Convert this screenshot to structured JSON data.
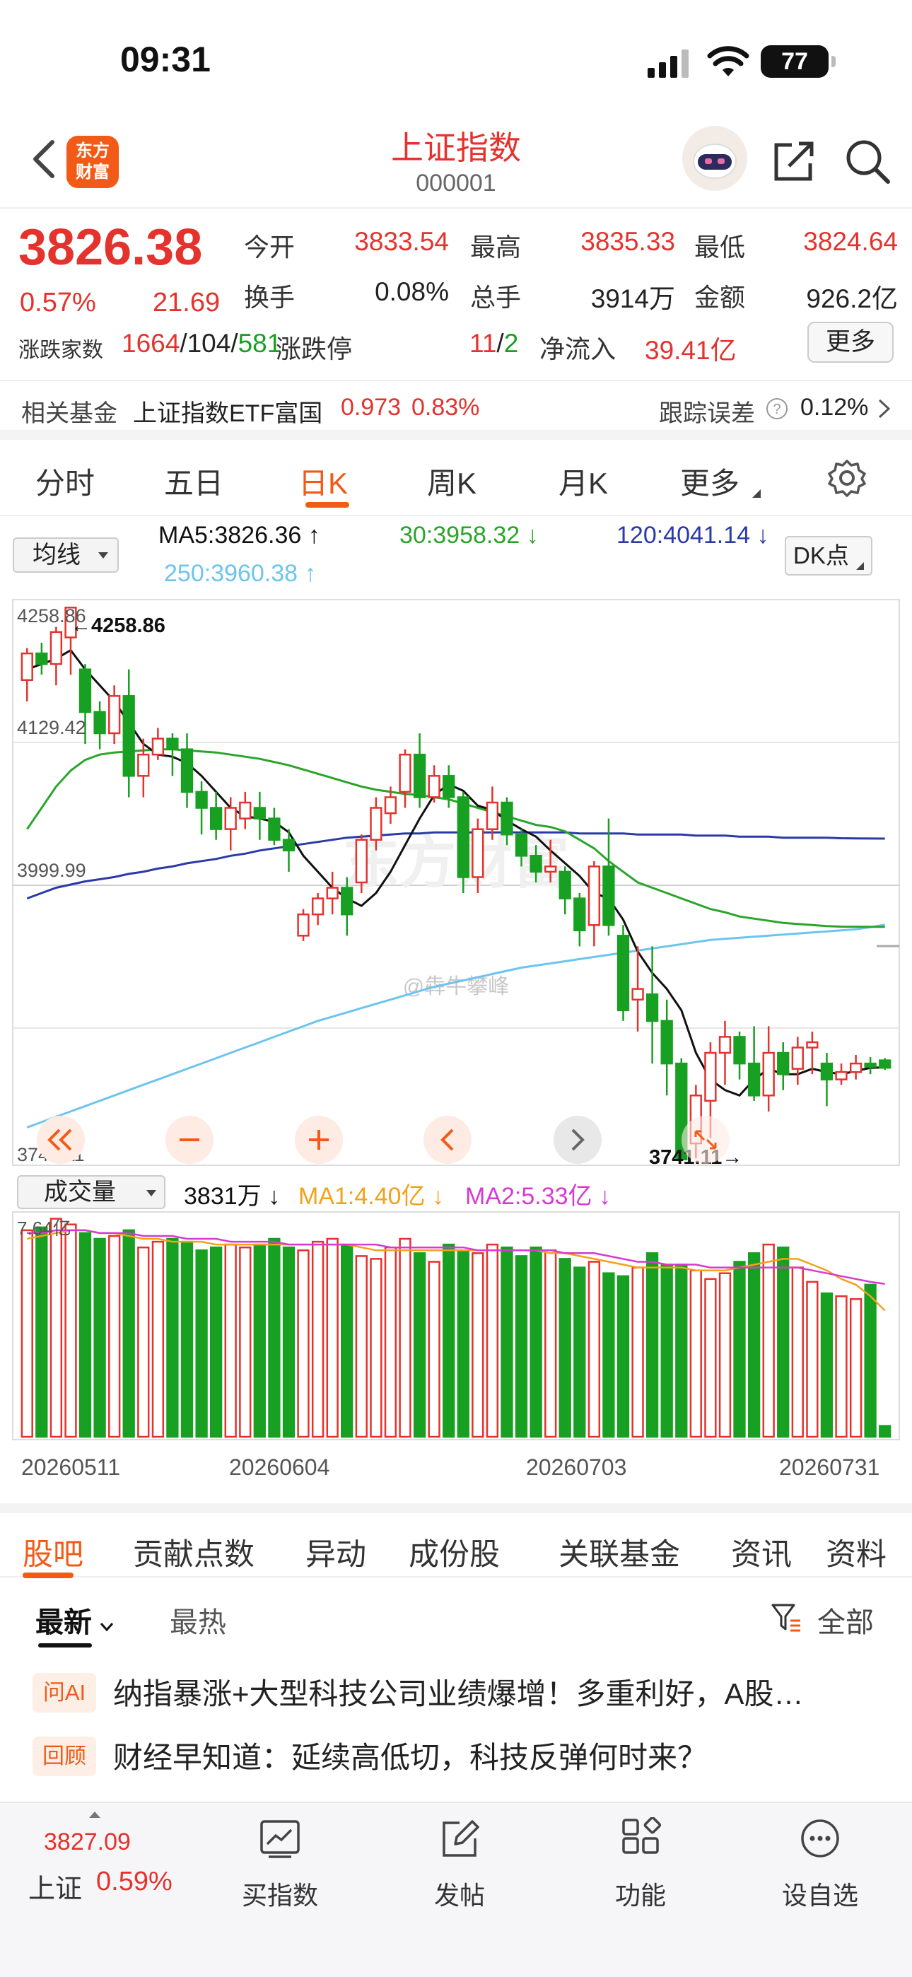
{
  "status_bar": {
    "time": "09:31",
    "battery": "77"
  },
  "header": {
    "title": "上证指数",
    "code": "000001",
    "logo_text_1": "东方",
    "logo_text_2": "财富"
  },
  "quote": {
    "price": "3826.38",
    "change_pct": "0.57%",
    "change": "21.69",
    "open_label": "今开",
    "open": "3833.54",
    "high_label": "最高",
    "high": "3835.33",
    "low_label": "最低",
    "low": "3824.64",
    "turnover_label": "换手",
    "turnover": "0.08%",
    "volume_label": "总手",
    "volume": "3914万",
    "amount_label": "金额",
    "amount": "926.2亿",
    "breadth_label": "涨跌家数",
    "breadth_up": "1664",
    "breadth_flat": "104",
    "breadth_down": "581",
    "limit_label": "涨跌停",
    "limit_up": "11",
    "limit_down": "2",
    "netflow_label": "净流入",
    "netflow": "39.41亿",
    "more_label": "更多"
  },
  "fund": {
    "label": "相关基金",
    "name": "上证指数ETF富国",
    "price": "0.973",
    "pct": "0.83%",
    "track_label": "跟踪误差",
    "track_value": "0.12%"
  },
  "period_tabs": [
    "分时",
    "五日",
    "日K",
    "周K",
    "月K",
    "更多"
  ],
  "ma": {
    "select_label": "均线",
    "ma5": "MA5:3826.36",
    "ma30": "30:3958.32",
    "ma120": "120:4041.14",
    "ma250": "250:3960.38",
    "dk_label": "DK点"
  },
  "chart_labels": {
    "ytick_top": "4258.86",
    "ytick_2": "4129.42",
    "ytick_3": "3999.99",
    "ytick_bottom": "3741.11",
    "high_marker": "←4258.86",
    "low_marker": "3741.11→",
    "watermark": "东方财富",
    "weibo_mark": "@犇牛攀峰"
  },
  "volume": {
    "select_label": "成交量",
    "value": "3831万",
    "ma1": "MA1:4.40亿",
    "ma2": "MA2:5.33亿",
    "ytick_top": "7.64亿"
  },
  "dates": [
    "20260511",
    "20260604",
    "20260703",
    "20260731"
  ],
  "colors": {
    "up": "#e4322d",
    "down": "#17a021",
    "ma5": "#111111",
    "ma30": "#2aa52a",
    "ma120": "#2a3aa8",
    "ma250": "#6cc4ef",
    "accent": "#f25a17"
  },
  "chart_data": {
    "type": "candlestick",
    "x": [
      "20260511",
      "20260512",
      "20260513",
      "20260514",
      "20260515",
      "20260518",
      "20260519",
      "20260520",
      "20260521",
      "20260522",
      "20260525",
      "20260526",
      "20260527",
      "20260528",
      "20260529",
      "20260601",
      "20260602",
      "20260603",
      "20260604",
      "20260605",
      "20260608",
      "20260609",
      "20260610",
      "20260611",
      "20260612",
      "20260615",
      "20260616",
      "20260617",
      "20260618",
      "20260619",
      "20260622",
      "20260623",
      "20260624",
      "20260625",
      "20260626",
      "20260629",
      "20260630",
      "20260701",
      "20260702",
      "20260703",
      "20260706",
      "20260707",
      "20260708",
      "20260709",
      "20260710",
      "20260713",
      "20260714",
      "20260715",
      "20260716",
      "20260717",
      "20260720",
      "20260721",
      "20260722",
      "20260723",
      "20260724",
      "20260727",
      "20260728",
      "20260729",
      "20260730",
      "20260731"
    ],
    "series": [
      {
        "name": "candles",
        "values": [
          [
            4190,
            4215,
            4170,
            4220
          ],
          [
            4215,
            4205,
            4195,
            4225
          ],
          [
            4205,
            4235,
            4185,
            4240
          ],
          [
            4230,
            4258,
            4195,
            4258.86
          ],
          [
            4200,
            4160,
            4130,
            4205
          ],
          [
            4160,
            4140,
            4125,
            4170
          ],
          [
            4140,
            4175,
            4130,
            4185
          ],
          [
            4175,
            4100,
            4080,
            4200
          ],
          [
            4100,
            4120,
            4080,
            4135
          ],
          [
            4120,
            4135,
            4115,
            4145
          ],
          [
            4135,
            4125,
            4100,
            4140
          ],
          [
            4125,
            4085,
            4070,
            4140
          ],
          [
            4085,
            4070,
            4045,
            4095
          ],
          [
            4070,
            4050,
            4040,
            4085
          ],
          [
            4050,
            4070,
            4030,
            4080
          ],
          [
            4060,
            4075,
            4050,
            4085
          ],
          [
            4070,
            4060,
            4040,
            4085
          ],
          [
            4060,
            4040,
            4035,
            4070
          ],
          [
            4040,
            4030,
            4010,
            4050
          ],
          [
            3950,
            3970,
            3945,
            3975
          ],
          [
            3970,
            3985,
            3960,
            3990
          ],
          [
            3985,
            3995,
            3970,
            4010
          ],
          [
            3995,
            3970,
            3950,
            4005
          ],
          [
            4000,
            4040,
            3990,
            4045
          ],
          [
            4040,
            4070,
            4030,
            4080
          ],
          [
            4065,
            4080,
            4055,
            4090
          ],
          [
            4085,
            4120,
            4070,
            4125
          ],
          [
            4120,
            4080,
            4070,
            4140
          ],
          [
            4080,
            4100,
            4075,
            4110
          ],
          [
            4100,
            4080,
            4070,
            4110
          ],
          [
            4080,
            4005,
            3990,
            4085
          ],
          [
            4005,
            4050,
            3990,
            4060
          ],
          [
            4050,
            4075,
            4040,
            4090
          ],
          [
            4075,
            4045,
            4035,
            4080
          ],
          [
            4045,
            4025,
            4015,
            4050
          ],
          [
            4025,
            4010,
            4000,
            4035
          ],
          [
            4010,
            4015,
            4000,
            4040
          ],
          [
            4010,
            3985,
            3970,
            4015
          ],
          [
            3985,
            3955,
            3940,
            3990
          ],
          [
            3960,
            4015,
            3940,
            4020
          ],
          [
            4015,
            3960,
            3950,
            4060
          ],
          [
            3950,
            3880,
            3870,
            3960
          ],
          [
            3890,
            3900,
            3860,
            3940
          ],
          [
            3895,
            3870,
            3830,
            3940
          ],
          [
            3870,
            3830,
            3800,
            3890
          ],
          [
            3830,
            3740,
            3741.11,
            3835
          ],
          [
            3755,
            3800,
            3741.11,
            3810
          ],
          [
            3795,
            3840,
            3760,
            3850
          ],
          [
            3840,
            3855,
            3810,
            3870
          ],
          [
            3855,
            3830,
            3815,
            3860
          ],
          [
            3830,
            3800,
            3795,
            3865
          ],
          [
            3800,
            3840,
            3785,
            3865
          ],
          [
            3840,
            3820,
            3805,
            3850
          ],
          [
            3825,
            3845,
            3810,
            3855
          ],
          [
            3845,
            3850,
            3820,
            3860
          ],
          [
            3830,
            3815,
            3790,
            3840
          ],
          [
            3815,
            3822,
            3810,
            3830
          ],
          [
            3822,
            3830,
            3815,
            3838
          ],
          [
            3830,
            3827,
            3820,
            3836
          ],
          [
            3833,
            3826,
            3824,
            3835
          ]
        ]
      },
      {
        "name": "MA5",
        "values": [
          4200,
          4205,
          4210,
          4218,
          4200,
          4185,
          4170,
          4150,
          4130,
          4120,
          4118,
          4112,
          4100,
          4085,
          4070,
          4062,
          4060,
          4057,
          4047,
          4025,
          4010,
          3995,
          3985,
          3978,
          3990,
          4010,
          4035,
          4060,
          4082,
          4092,
          4086,
          4072,
          4068,
          4058,
          4050,
          4043,
          4030,
          4018,
          4006,
          3990,
          3985,
          3965,
          3935,
          3915,
          3900,
          3880,
          3840,
          3815,
          3805,
          3800,
          3815,
          3825,
          3820,
          3820,
          3825,
          3822,
          3820,
          3823,
          3826,
          3826.36
        ]
      },
      {
        "name": "30",
        "values": [
          4050,
          4070,
          4090,
          4105,
          4115,
          4120,
          4122,
          4123,
          4124,
          4125,
          4125,
          4124,
          4123,
          4122,
          4120,
          4118,
          4116,
          4113,
          4110,
          4106,
          4102,
          4098,
          4094,
          4090,
          4087,
          4085,
          4083,
          4082,
          4080,
          4078,
          4074,
          4070,
          4066,
          4062,
          4058,
          4054,
          4052,
          4048,
          4040,
          4032,
          4020,
          4010,
          4000,
          3995,
          3990,
          3985,
          3980,
          3975,
          3972,
          3968,
          3966,
          3964,
          3962,
          3961,
          3960,
          3959,
          3958.5,
          3958.4,
          3958.3,
          3958.32
        ]
      },
      {
        "name": "120",
        "values": [
          3985,
          3990,
          3995,
          3998,
          4001,
          4003,
          4005,
          4008,
          4010,
          4013,
          4015,
          4018,
          4020,
          4022,
          4025,
          4027,
          4030,
          4032,
          4034,
          4036,
          4038,
          4040,
          4042,
          4043,
          4044,
          4045,
          4046,
          4046,
          4047,
          4047,
          4047,
          4047,
          4047,
          4047,
          4047,
          4047,
          4047,
          4047,
          4046,
          4046,
          4046,
          4046,
          4045,
          4045,
          4045,
          4045,
          4044,
          4044,
          4044,
          4043,
          4043,
          4043,
          4042,
          4042,
          4042,
          4042,
          4041.5,
          4041.3,
          4041.2,
          4041.14
        ]
      },
      {
        "name": "250",
        "values": [
          3770,
          3775,
          3780,
          3785,
          3790,
          3795,
          3800,
          3805,
          3810,
          3815,
          3820,
          3825,
          3830,
          3835,
          3840,
          3845,
          3850,
          3855,
          3860,
          3865,
          3870,
          3874,
          3878,
          3882,
          3886,
          3890,
          3894,
          3898,
          3902,
          3905,
          3908,
          3911,
          3914,
          3917,
          3920,
          3922,
          3924,
          3926,
          3928,
          3930,
          3932,
          3934,
          3936,
          3938,
          3940,
          3942,
          3944,
          3946,
          3947,
          3948,
          3949,
          3950,
          3951,
          3952,
          3953,
          3954,
          3955,
          3956,
          3958,
          3960.38
        ]
      },
      {
        "name": "成交量",
        "values": [
          7.2,
          7.3,
          7.6,
          7.4,
          7.1,
          6.9,
          7.0,
          7.2,
          6.6,
          6.8,
          6.9,
          6.8,
          6.5,
          6.6,
          6.7,
          6.6,
          6.7,
          6.9,
          6.6,
          6.5,
          6.8,
          6.9,
          6.7,
          6.3,
          6.2,
          6.6,
          6.9,
          6.4,
          6.1,
          6.7,
          6.5,
          6.4,
          6.7,
          6.6,
          6.3,
          6.6,
          6.5,
          6.2,
          5.9,
          6.1,
          5.7,
          5.6,
          5.9,
          6.4,
          6.0,
          6.0,
          5.8,
          5.5,
          5.7,
          6.1,
          6.4,
          6.7,
          6.6,
          5.9,
          5.4,
          5.0,
          4.9,
          4.8,
          5.3,
          0.38
        ]
      },
      {
        "name": "MA1",
        "values": [
          6.9,
          7.0,
          7.1,
          7.2,
          7.2,
          7.1,
          7.1,
          7.0,
          6.9,
          6.9,
          6.8,
          6.8,
          6.8,
          6.7,
          6.7,
          6.7,
          6.7,
          6.7,
          6.7,
          6.7,
          6.7,
          6.7,
          6.7,
          6.6,
          6.5,
          6.5,
          6.5,
          6.5,
          6.5,
          6.5,
          6.5,
          6.5,
          6.5,
          6.5,
          6.5,
          6.5,
          6.4,
          6.4,
          6.3,
          6.2,
          6.1,
          6.0,
          5.9,
          5.9,
          5.9,
          5.9,
          5.8,
          5.8,
          5.8,
          5.9,
          6.0,
          6.1,
          6.2,
          6.2,
          6.0,
          5.8,
          5.5,
          5.3,
          4.9,
          4.4
        ]
      },
      {
        "name": "MA2",
        "values": [
          7.1,
          7.1,
          7.2,
          7.2,
          7.2,
          7.1,
          7.1,
          7.1,
          7.0,
          7.0,
          7.0,
          6.9,
          6.9,
          6.9,
          6.8,
          6.8,
          6.8,
          6.8,
          6.7,
          6.7,
          6.7,
          6.7,
          6.7,
          6.7,
          6.7,
          6.6,
          6.6,
          6.6,
          6.6,
          6.6,
          6.6,
          6.5,
          6.5,
          6.5,
          6.5,
          6.5,
          6.5,
          6.4,
          6.4,
          6.4,
          6.3,
          6.2,
          6.1,
          6.1,
          6.0,
          6.0,
          6.0,
          5.9,
          5.9,
          5.9,
          5.9,
          5.9,
          5.9,
          5.9,
          5.8,
          5.7,
          5.6,
          5.5,
          5.4,
          5.33
        ]
      }
    ],
    "ylim": [
      3741.11,
      4258.86
    ],
    "volume_ylim": [
      0,
      7.64
    ]
  },
  "sub_tabs": [
    "股吧",
    "贡献点数",
    "异动",
    "成份股",
    "关联基金",
    "资讯",
    "资料"
  ],
  "sort": {
    "latest": "最新",
    "hottest": "最热",
    "filter": "全部"
  },
  "news": [
    {
      "badge": "问AI",
      "text": "纳指暴涨+大型科技公司业绩爆增！多重利好，A股…"
    },
    {
      "badge": "回顾",
      "text": "财经早知道：延续高低切，科技反弹何时来？"
    }
  ],
  "bottom_bar": {
    "index_value": "3827.09",
    "index_name": "上证",
    "index_pct": "0.59%",
    "items": [
      "买指数",
      "发帖",
      "功能",
      "设自选"
    ]
  }
}
